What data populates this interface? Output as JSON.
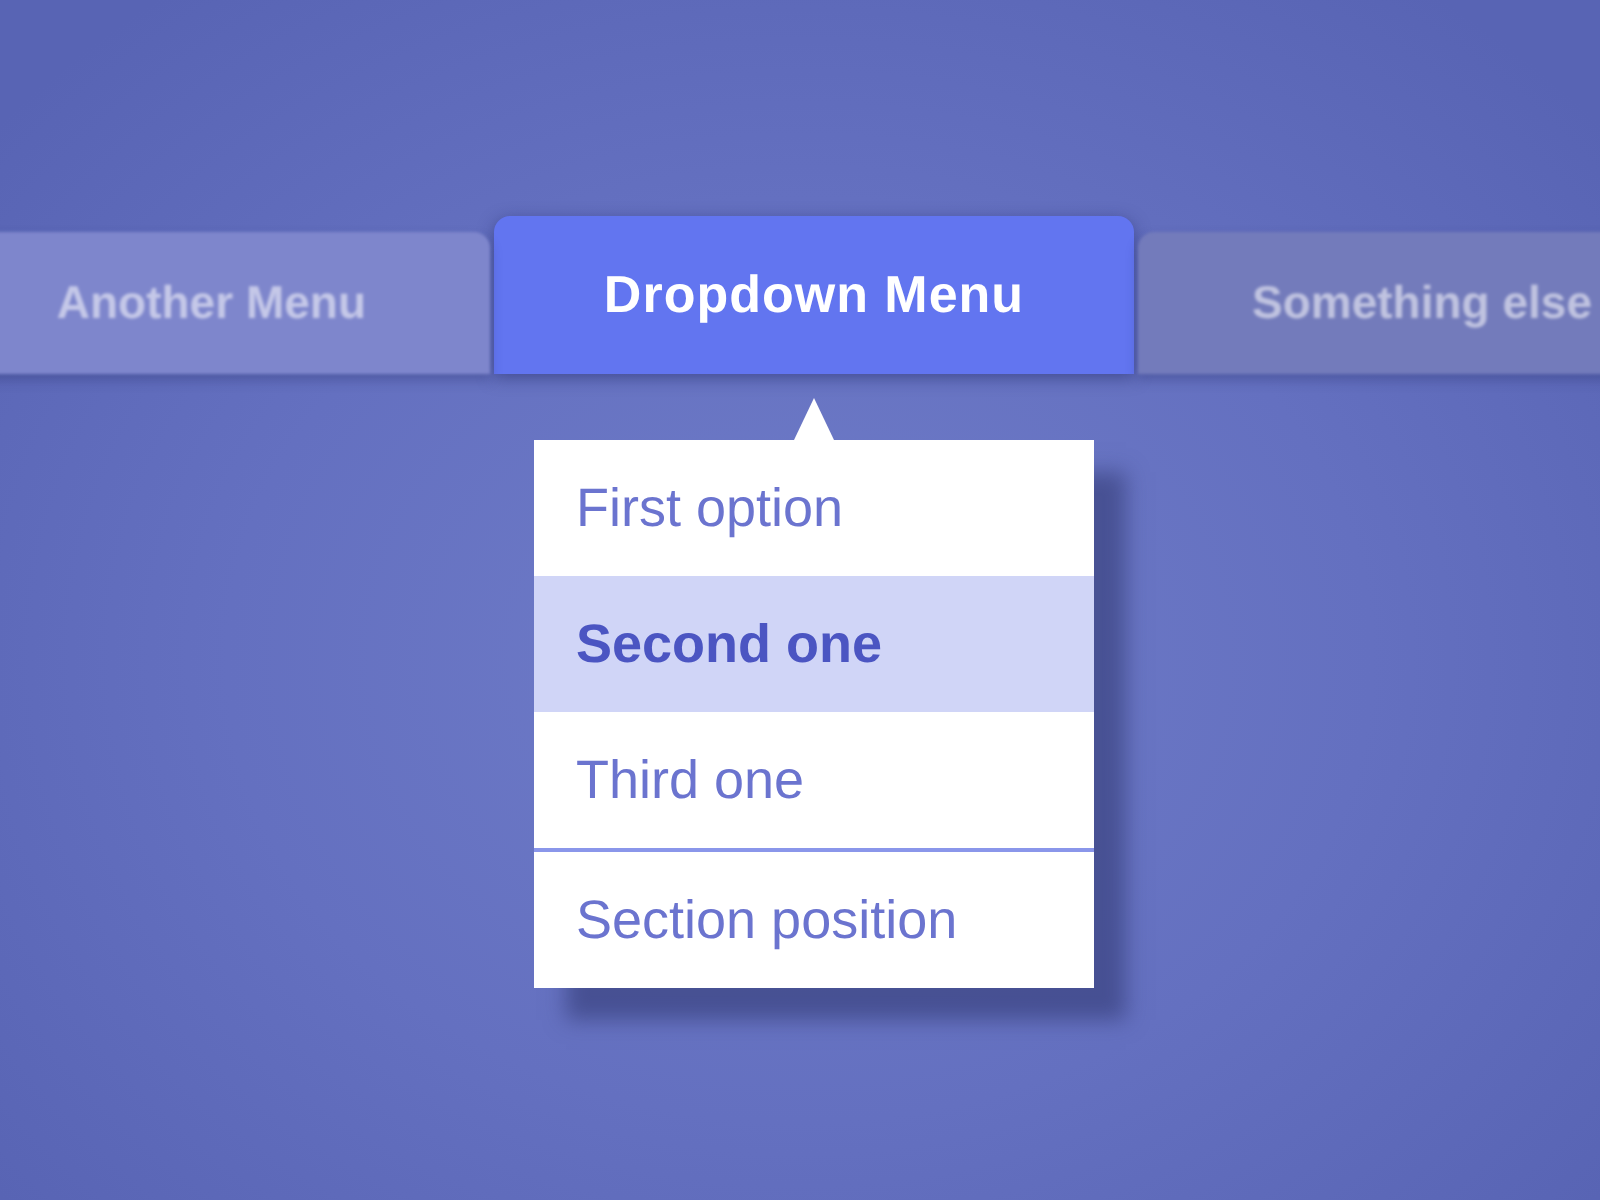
{
  "tabs": [
    {
      "label": "Another Menu",
      "selected": false
    },
    {
      "label": "Dropdown Menu",
      "selected": true
    },
    {
      "label": "Something else",
      "selected": false
    }
  ],
  "dropdown": {
    "groups": [
      [
        {
          "label": "First option",
          "selected": false
        },
        {
          "label": "Second one",
          "selected": true
        },
        {
          "label": "Third one",
          "selected": false
        }
      ],
      [
        {
          "label": "Section position",
          "selected": false
        }
      ]
    ]
  }
}
